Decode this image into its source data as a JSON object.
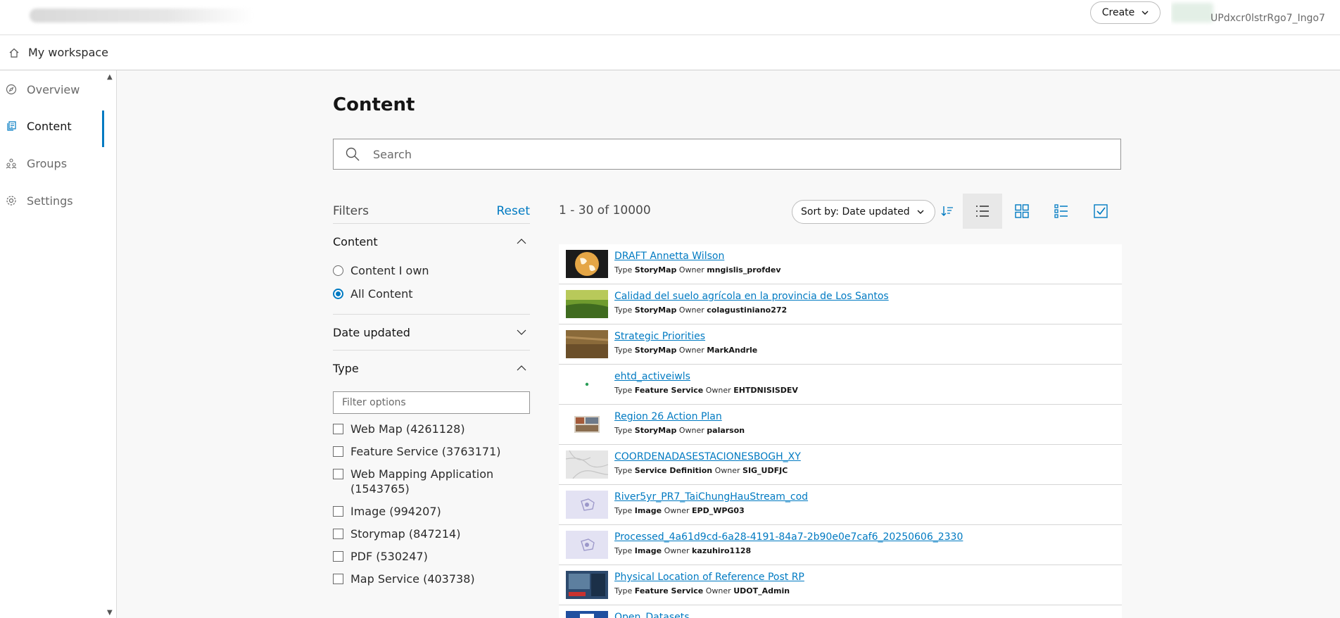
{
  "header": {
    "create_label": "Create",
    "user_name": "UPdxcr0lstrRgo7_Ingo7"
  },
  "workspace": {
    "label": "My workspace"
  },
  "sidebar": {
    "items": [
      {
        "label": "Overview"
      },
      {
        "label": "Content"
      },
      {
        "label": "Groups"
      },
      {
        "label": "Settings"
      }
    ]
  },
  "main": {
    "title": "Content",
    "search_placeholder": "Search",
    "result_count": "1 - 30 of 10000",
    "sort_label": "Sort by: Date updated"
  },
  "filters": {
    "title": "Filters",
    "reset_label": "Reset",
    "content_section": {
      "title": "Content",
      "options": [
        {
          "label": "Content I own",
          "checked": false
        },
        {
          "label": "All Content",
          "checked": true
        }
      ]
    },
    "date_section": {
      "title": "Date updated"
    },
    "type_section": {
      "title": "Type",
      "filter_placeholder": "Filter options",
      "options": [
        {
          "label": "Web Map (4261128)"
        },
        {
          "label": "Feature Service (3763171)"
        },
        {
          "label": "Web Mapping Application (1543765)"
        },
        {
          "label": "Image (994207)"
        },
        {
          "label": "Storymap (847214)"
        },
        {
          "label": "PDF (530247)"
        },
        {
          "label": "Map Service (403738)"
        }
      ]
    }
  },
  "labels": {
    "type": "Type",
    "owner": "Owner"
  },
  "items": [
    {
      "title": "DRAFT Annetta Wilson",
      "type": "StoryMap",
      "owner": "mngislis_profdev",
      "thumb": "globe"
    },
    {
      "title": "Calidad del suelo agrícola en la provincia de Los Santos",
      "type": "StoryMap",
      "owner": "colagustiniano272",
      "thumb": "field"
    },
    {
      "title": "Strategic Priorities",
      "type": "StoryMap",
      "owner": "MarkAndrle",
      "thumb": "grass"
    },
    {
      "title": "ehtd_activeiwls",
      "type": "Feature Service",
      "owner": "EHTDNISISDEV",
      "thumb": "dot"
    },
    {
      "title": "Region 26 Action Plan",
      "type": "StoryMap",
      "owner": "palarson",
      "thumb": "collage"
    },
    {
      "title": "COORDENADASESTACIONESBOGH_XY",
      "type": "Service Definition",
      "owner": "SIG_UDFJC",
      "thumb": "map"
    },
    {
      "title": "River5yr_PR7_TaiChungHauStream_cod",
      "type": "Image",
      "owner": "EPD_WPG03",
      "thumb": "placeholder"
    },
    {
      "title": "Processed_4a61d9cd-6a28-4191-84a7-2b90e0e7caf6_20250606_2330",
      "type": "Image",
      "owner": "kazuhiro1128",
      "thumb": "placeholder"
    },
    {
      "title": "Physical Location of Reference Post RP",
      "type": "Feature Service",
      "owner": "UDOT_Admin",
      "thumb": "udot"
    },
    {
      "title": "Open_Datasets",
      "type": "",
      "owner": "",
      "thumb": "blue"
    }
  ]
}
